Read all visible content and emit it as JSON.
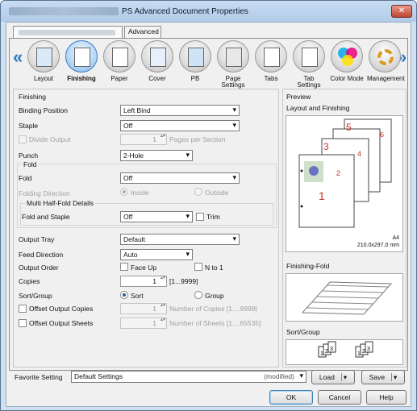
{
  "window": {
    "title": "PS Advanced Document Properties",
    "close_label": "✕"
  },
  "tabs": {
    "advanced": "Advanced"
  },
  "categories": [
    {
      "label": "Layout"
    },
    {
      "label": "Finishing"
    },
    {
      "label": "Paper"
    },
    {
      "label": "Cover"
    },
    {
      "label": "PB"
    },
    {
      "label": "Page Settings"
    },
    {
      "label": "Tabs"
    },
    {
      "label": "Tab Settings"
    },
    {
      "label": "Color Mode"
    },
    {
      "label": "Management"
    }
  ],
  "nav": {
    "prev": "«",
    "next": "»"
  },
  "finishing": {
    "section_label": "Finishing",
    "binding_position": {
      "label": "Binding Position",
      "value": "Left Bind"
    },
    "staple": {
      "label": "Staple",
      "value": "Off"
    },
    "divide_output": {
      "label": "Divide Output",
      "value": "1",
      "suffix": "Pages per Section"
    },
    "punch": {
      "label": "Punch",
      "value": "2-Hole"
    },
    "fold_group": "Fold",
    "fold": {
      "label": "Fold",
      "value": "Off"
    },
    "folding_direction": {
      "label": "Folding Direction",
      "inside": "Inside",
      "outside": "Outside"
    },
    "multi_half_fold": "Multi Half-Fold Details",
    "fold_and_staple": {
      "label": "Fold and Staple",
      "value": "Off",
      "trim": "Trim"
    },
    "output_tray": {
      "label": "Output Tray",
      "value": "Default"
    },
    "feed_direction": {
      "label": "Feed Direction",
      "value": "Auto"
    },
    "output_order": {
      "label": "Output Order",
      "face_up": "Face Up",
      "n_to_1": "N to 1"
    },
    "copies": {
      "label": "Copies",
      "value": "1",
      "range": "[1...9999]"
    },
    "sort_group": {
      "label": "Sort/Group",
      "sort": "Sort",
      "group": "Group"
    },
    "offset_output_copies": {
      "label": "Offset Output Copies",
      "value": "1",
      "suffix": "Number of Copies [1....9999]"
    },
    "offset_output_sheets": {
      "label": "Offset Output Sheets",
      "value": "1",
      "suffix": "Number of Sheets [1....65535]"
    }
  },
  "preview": {
    "section_label": "Preview",
    "layout_label": "Layout and Finishing",
    "page_numbers": [
      "1",
      "3",
      "4",
      "5",
      "6",
      "2"
    ],
    "paper_size": "A4",
    "paper_dims": "210.0x297.0 mm",
    "finishing_fold_label": "Finishing-Fold",
    "sort_group_label": "Sort/Group",
    "sort_pages": [
      "1",
      "2",
      "3"
    ]
  },
  "footer": {
    "favorite_label": "Favorite Setting",
    "favorite_value": "Default Settings",
    "favorite_status": "(modified)",
    "load": "Load",
    "save": "Save",
    "ok": "OK",
    "cancel": "Cancel",
    "help": "Help"
  },
  "colors": {
    "accent": "#2a79c3",
    "page_number_red": "#c8322b"
  }
}
